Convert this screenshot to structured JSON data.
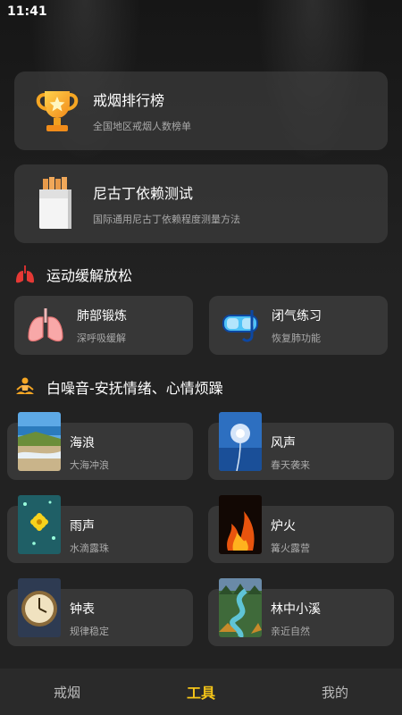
{
  "status_bar": {
    "time": "11:41"
  },
  "ranking_card": {
    "title": "戒烟排行榜",
    "subtitle": "全国地区戒烟人数榜单",
    "icon": "trophy-icon"
  },
  "nicotine_card": {
    "title": "尼古丁依赖测试",
    "subtitle": "国际通用尼古丁依赖程度测量方法",
    "icon": "cigarette-pack-icon"
  },
  "exercise_section": {
    "heading": "运动缓解放松",
    "icon": "lungs-icon",
    "items": [
      {
        "title": "肺部锻炼",
        "subtitle": "深呼吸缓解",
        "icon": "lungs-icon"
      },
      {
        "title": "闭气练习",
        "subtitle": "恢复肺功能",
        "icon": "diving-mask-icon"
      }
    ]
  },
  "noise_section": {
    "heading": "白噪音-安抚情绪、心情烦躁",
    "icon": "meditation-icon",
    "items": [
      {
        "title": "海浪",
        "subtitle": "大海冲浪",
        "thumb": "sea-thumb"
      },
      {
        "title": "风声",
        "subtitle": "春天袭来",
        "thumb": "dandelion-thumb"
      },
      {
        "title": "雨声",
        "subtitle": "水滴露珠",
        "thumb": "rain-flower-thumb"
      },
      {
        "title": "炉火",
        "subtitle": "篝火露营",
        "thumb": "fire-thumb"
      },
      {
        "title": "钟表",
        "subtitle": "规律稳定",
        "thumb": "clock-thumb"
      },
      {
        "title": "林中小溪",
        "subtitle": "亲近自然",
        "thumb": "forest-stream-thumb"
      }
    ]
  },
  "tab_bar": {
    "tabs": [
      {
        "label": "戒烟"
      },
      {
        "label": "工具"
      },
      {
        "label": "我的"
      }
    ],
    "active_color": "#f5c518"
  }
}
